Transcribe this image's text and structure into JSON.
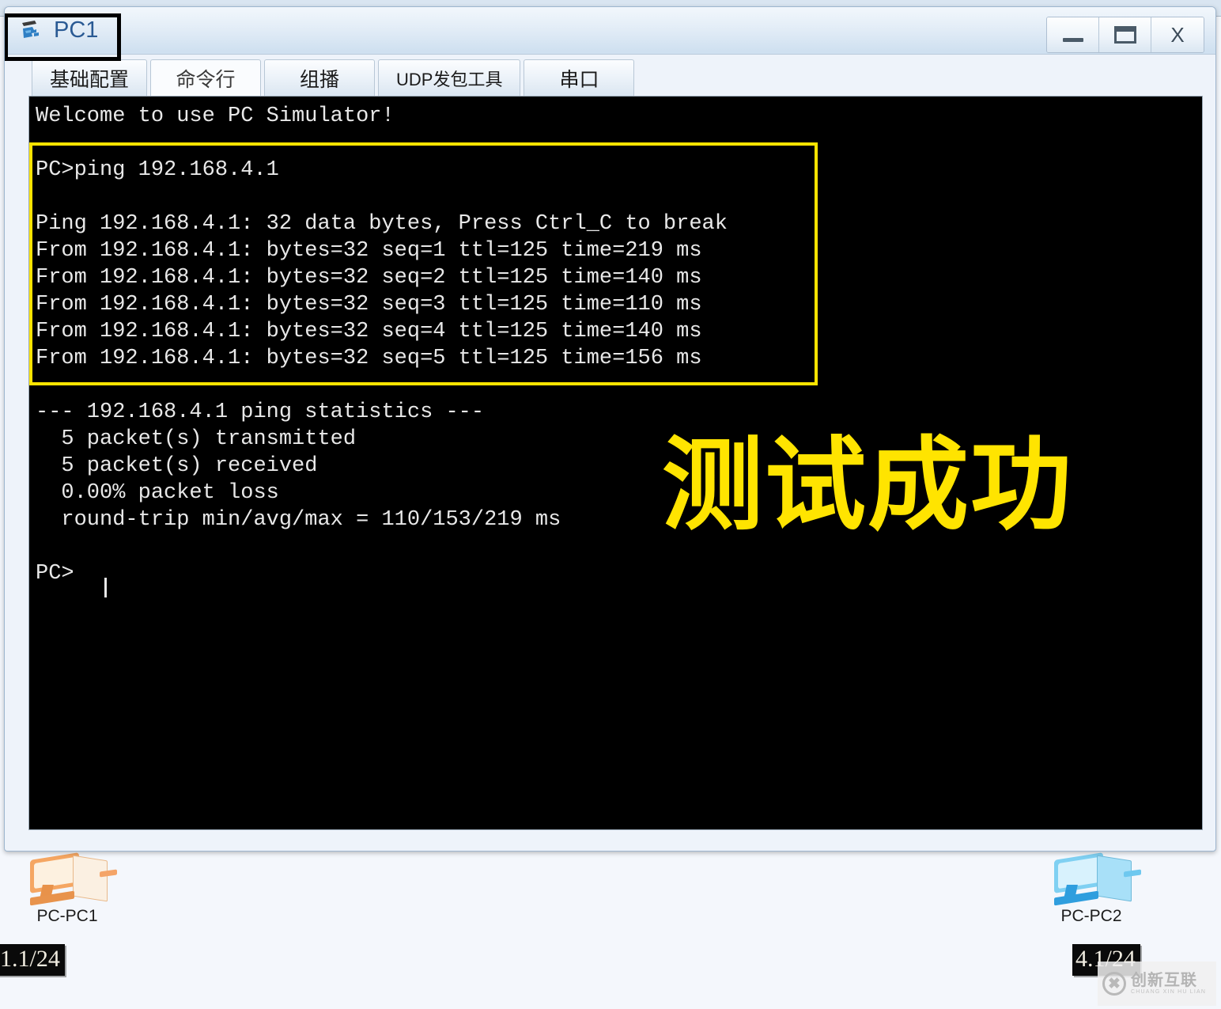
{
  "background": {
    "ghost_title": "",
    "nodes": [
      {
        "name": "pc1",
        "label": "PC-PC1",
        "ip_tag": "1.1/24",
        "color": "#f0a05a",
        "style": "pc-orange"
      },
      {
        "name": "pc2",
        "label": "PC-PC2",
        "ip_tag": "4.1/24",
        "color": "#3fa9e0",
        "style": "pc-blue"
      }
    ]
  },
  "watermark": {
    "logo_glyph": "✖",
    "cn": "创新互联",
    "en": "CHUANG XIN HU LIAN"
  },
  "window": {
    "title": "PC1",
    "icon": "pc-terminal-icon",
    "controls": {
      "minimize": "–",
      "maximize": "□",
      "close": "X"
    }
  },
  "tabs": [
    {
      "label": "基础配置",
      "active": false,
      "name": "tab-basic-config"
    },
    {
      "label": "命令行",
      "active": true,
      "name": "tab-command-line"
    },
    {
      "label": "组播",
      "active": false,
      "name": "tab-multicast"
    },
    {
      "label": "UDP发包工具",
      "active": false,
      "name": "tab-udp-tool",
      "small": true
    },
    {
      "label": "串口",
      "active": false,
      "name": "tab-serial"
    }
  ],
  "terminal": {
    "banner": "Welcome to use PC Simulator!",
    "lines": [
      "Welcome to use PC Simulator!",
      "",
      "PC>ping 192.168.4.1",
      "",
      "Ping 192.168.4.1: 32 data bytes, Press Ctrl_C to break",
      "From 192.168.4.1: bytes=32 seq=1 ttl=125 time=219 ms",
      "From 192.168.4.1: bytes=32 seq=2 ttl=125 time=140 ms",
      "From 192.168.4.1: bytes=32 seq=3 ttl=125 time=110 ms",
      "From 192.168.4.1: bytes=32 seq=4 ttl=125 time=140 ms",
      "From 192.168.4.1: bytes=32 seq=5 ttl=125 time=156 ms",
      "",
      "--- 192.168.4.1 ping statistics ---",
      "  5 packet(s) transmitted",
      "  5 packet(s) received",
      "  0.00% packet loss",
      "  round-trip min/avg/max = 110/153/219 ms",
      "",
      "PC>"
    ],
    "text": "Welcome to use PC Simulator!\n\nPC>ping 192.168.4.1\n\nPing 192.168.4.1: 32 data bytes, Press Ctrl_C to break\nFrom 192.168.4.1: bytes=32 seq=1 ttl=125 time=219 ms\nFrom 192.168.4.1: bytes=32 seq=2 ttl=125 time=140 ms\nFrom 192.168.4.1: bytes=32 seq=3 ttl=125 time=110 ms\nFrom 192.168.4.1: bytes=32 seq=4 ttl=125 time=140 ms\nFrom 192.168.4.1: bytes=32 seq=5 ttl=125 time=156 ms\n\n--- 192.168.4.1 ping statistics ---\n  5 packet(s) transmitted\n  5 packet(s) received\n  0.00% packet loss\n  round-trip min/avg/max = 110/153/219 ms\n\nPC>",
    "ping_target": "192.168.4.1",
    "ping_command": "PC>ping 192.168.4.1",
    "prompt": "PC>",
    "stats": {
      "transmitted": "5 packet(s) transmitted",
      "received": "5 packet(s) received",
      "loss": "0.00% packet loss",
      "rtt": "round-trip min/avg/max = 110/153/219 ms"
    },
    "annotation": {
      "success_text": "测试成功",
      "highlight_color": "#ffe400"
    }
  }
}
